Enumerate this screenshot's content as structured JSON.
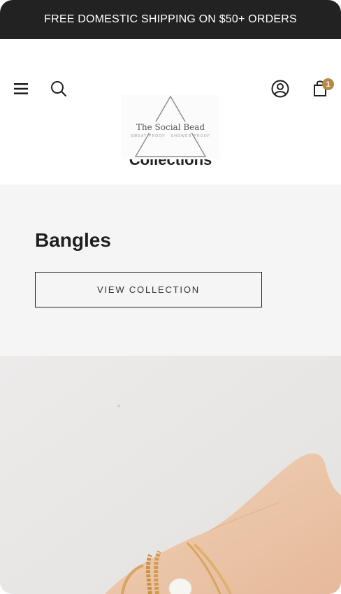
{
  "announcement": {
    "text": "FREE DOMESTIC SHIPPING ON $50+ ORDERS"
  },
  "header": {
    "logo": {
      "name": "The Social Bead",
      "tagline": "SWEAT-PROOF · SHOWER-PROOF"
    },
    "cart_count": "1",
    "icons": [
      "menu-icon",
      "search-icon",
      "account-icon",
      "cart-icon"
    ]
  },
  "page": {
    "title": "Collections"
  },
  "collections": [
    {
      "title": "Bangles",
      "button_label": "VIEW COLLECTION"
    }
  ],
  "colors": {
    "announcement_bg": "#222222",
    "badge": "#b48a49",
    "card_bg": "#f5f5f5",
    "text": "#1f1f1f"
  }
}
